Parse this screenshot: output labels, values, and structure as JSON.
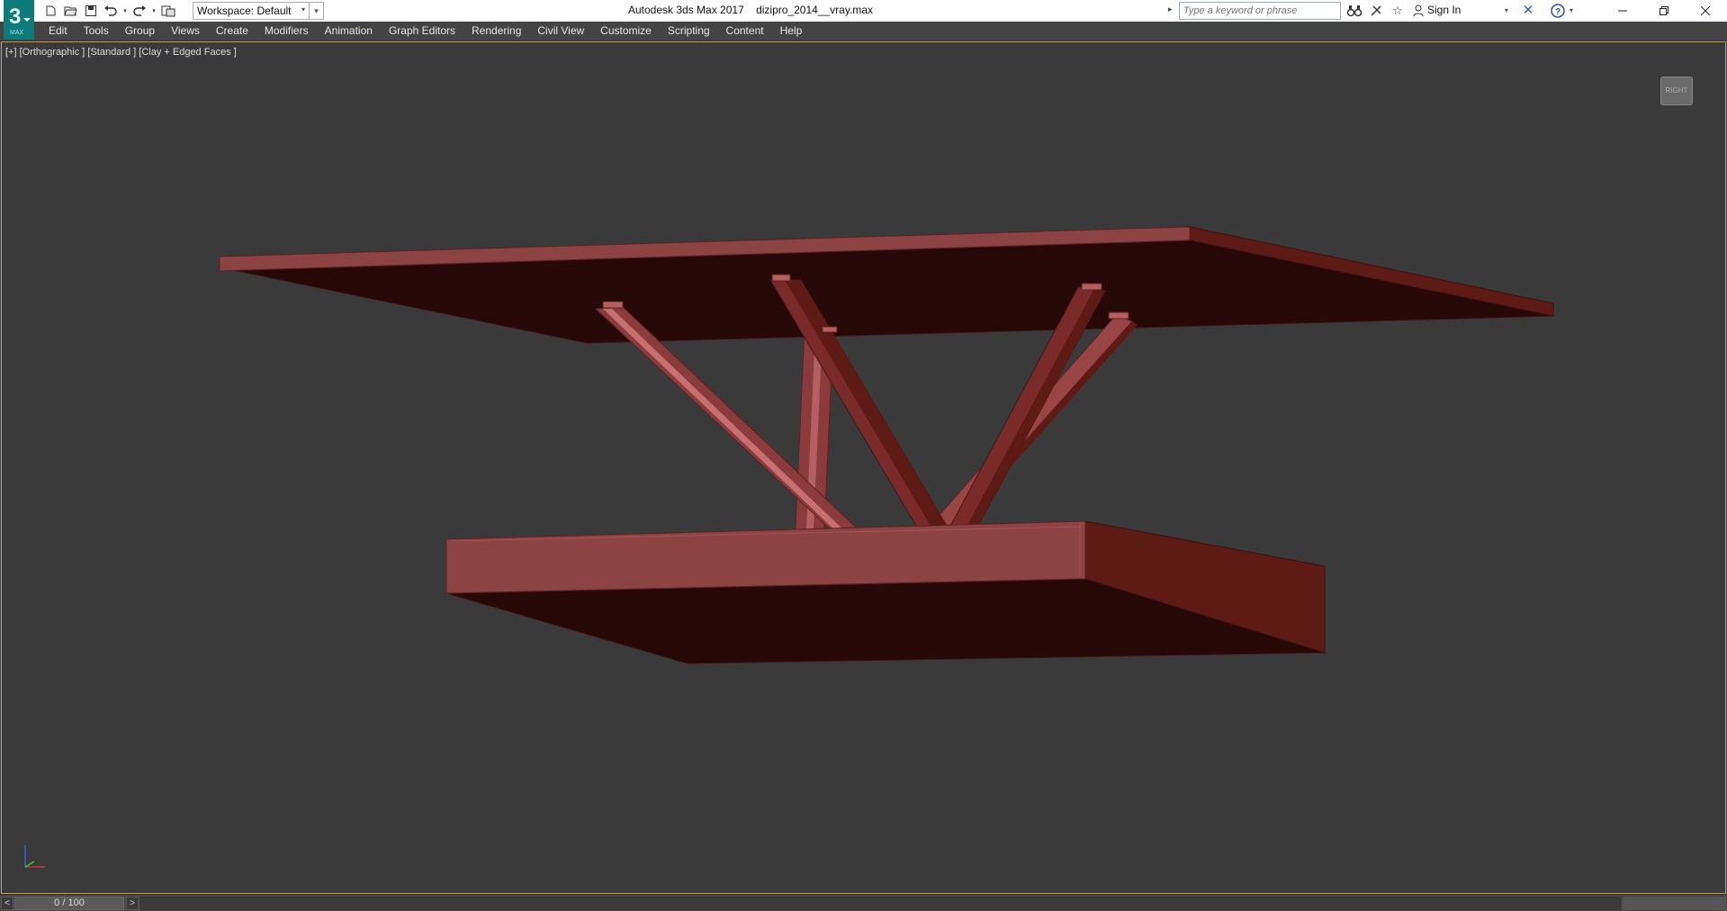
{
  "app": {
    "title": "Autodesk 3ds Max 2017",
    "file": "dizipro_2014__vray.max"
  },
  "workspace": {
    "label": "Workspace: Default"
  },
  "search": {
    "placeholder": "Type a keyword or phrase"
  },
  "account": {
    "sign_in": "Sign In"
  },
  "menu": {
    "items": [
      {
        "label": "Edit"
      },
      {
        "label": "Tools"
      },
      {
        "label": "Group"
      },
      {
        "label": "Views"
      },
      {
        "label": "Create"
      },
      {
        "label": "Modifiers"
      },
      {
        "label": "Animation"
      },
      {
        "label": "Graph Editors"
      },
      {
        "label": "Rendering"
      },
      {
        "label": "Civil View"
      },
      {
        "label": "Customize"
      },
      {
        "label": "Scripting"
      },
      {
        "label": "Content"
      },
      {
        "label": "Help"
      }
    ]
  },
  "viewport": {
    "label": "[+] [Orthographic ] [Standard ] [Clay + Edged Faces ]",
    "viewcube_label": "RIGHT"
  },
  "timeline": {
    "frame": "0 / 100",
    "prev": "<",
    "next": ">"
  },
  "colors": {
    "accent": "#c8a53a",
    "model_face": "#8b4343",
    "model_dark": "#260807",
    "model_side": "#5e1b16"
  },
  "icons": {
    "logo": "3ds-max-logo-icon",
    "new": "new-file-icon",
    "open": "open-file-icon",
    "save": "save-icon",
    "undo": "undo-icon",
    "redo": "redo-icon",
    "project": "project-folder-icon",
    "binoculars": "binoculars-icon",
    "star": "star-icon",
    "user": "user-icon",
    "exchange": "exchange-icon",
    "help": "help-icon"
  }
}
